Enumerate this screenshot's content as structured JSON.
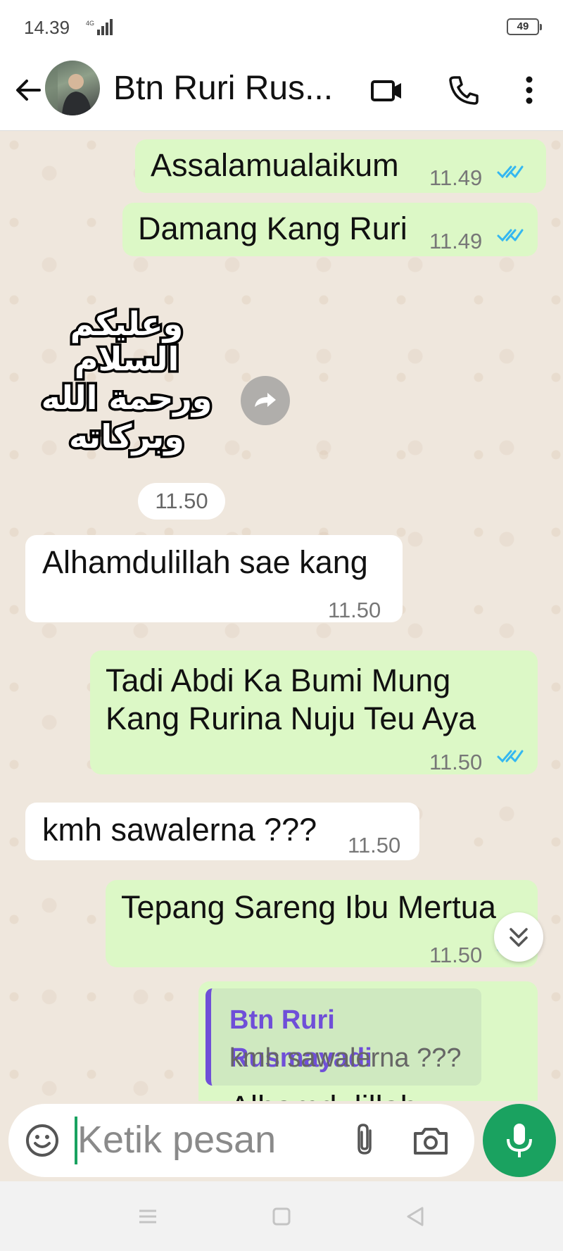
{
  "status_bar": {
    "time": "14.39",
    "network": "4G",
    "battery": "49"
  },
  "header": {
    "contact_name": "Btn Ruri Rus..."
  },
  "messages": [
    {
      "direction": "out",
      "text": "Assalamualaikum",
      "time": "11.49",
      "read": true
    },
    {
      "direction": "out",
      "text": "Damang Kang Ruri",
      "time": "11.49",
      "read": true
    },
    {
      "direction": "in",
      "type": "sticker",
      "sticker_text": "وعليكم السلام ورحمة الله وبركاته",
      "time": "11.50"
    },
    {
      "direction": "in",
      "text": "Alhamdulillah sae kang",
      "time": "11.50"
    },
    {
      "direction": "out",
      "text_line1": "Tadi Abdi Ka Bumi Mung",
      "text_line2": "Kang Rurina Nuju Teu Aya",
      "time": "11.50",
      "read": true
    },
    {
      "direction": "in",
      "text": "kmh sawalerna ???",
      "time": "11.50"
    },
    {
      "direction": "out",
      "text": "Tepang Sareng Ibu Mertua",
      "time": "11.50",
      "read": true
    },
    {
      "direction": "out",
      "reply_to_name": "Btn Ruri Rusmayadi",
      "reply_to_text": "kmh sawalerna ???",
      "text": "Alhamdulillah"
    }
  ],
  "input": {
    "placeholder": "Ketik pesan"
  },
  "colors": {
    "accent": "#1aa260",
    "outgoing_bubble": "#dcf8c6",
    "read_tick": "#34b7f1",
    "reply_name": "#6f4fd8"
  }
}
